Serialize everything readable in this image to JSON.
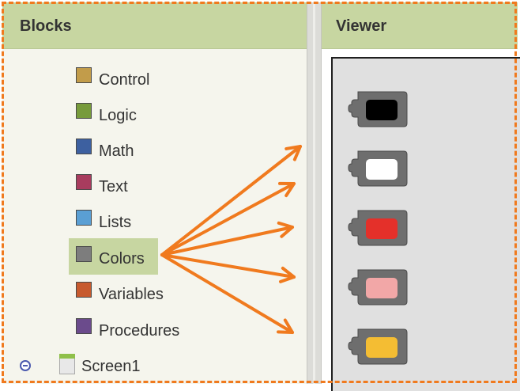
{
  "blocks_panel": {
    "title": "Blocks",
    "items": [
      {
        "label": "Control",
        "color": "#c29c4a"
      },
      {
        "label": "Logic",
        "color": "#779b3b"
      },
      {
        "label": "Math",
        "color": "#3d60a0"
      },
      {
        "label": "Text",
        "color": "#a83c5e"
      },
      {
        "label": "Lists",
        "color": "#5a9fd4"
      },
      {
        "label": "Colors",
        "color": "#7d7d7d"
      },
      {
        "label": "Variables",
        "color": "#c75a2e"
      },
      {
        "label": "Procedures",
        "color": "#6b4b8c"
      }
    ],
    "selected_item": "Colors",
    "screen": {
      "label": "Screen1",
      "expander_icon": "collapse-minus-icon",
      "icon": "screen-icon"
    }
  },
  "viewer_panel": {
    "title": "Viewer",
    "color_blocks": [
      {
        "name": "black",
        "color": "#000000"
      },
      {
        "name": "white",
        "color": "#ffffff"
      },
      {
        "name": "red",
        "color": "#e4302a"
      },
      {
        "name": "pink",
        "color": "#f2a7a7"
      },
      {
        "name": "orange",
        "color": "#f4bd33"
      }
    ]
  },
  "annotation": {
    "arrow_color": "#f07a1e",
    "border_color": "#f07a1e",
    "border_style": "dashed"
  }
}
